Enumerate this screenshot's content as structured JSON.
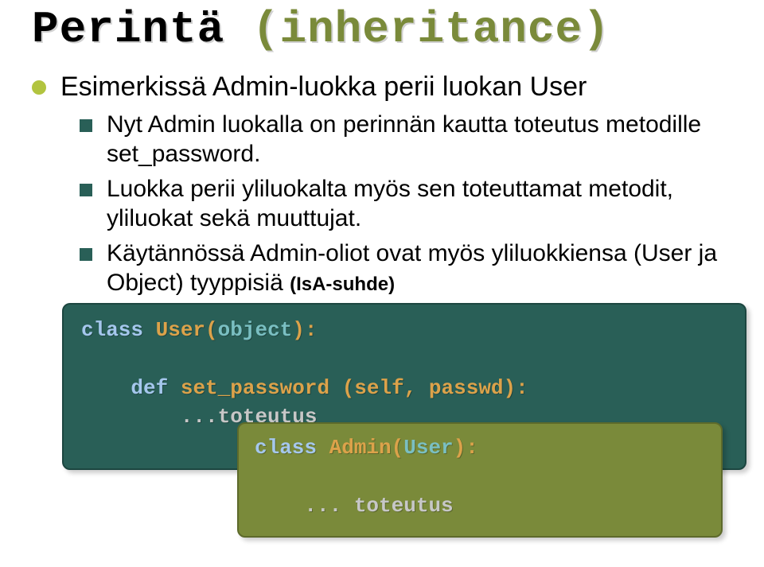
{
  "title": {
    "main": "Perintä",
    "paren": "(inheritance)"
  },
  "bullet": "Esimerkissä Admin-luokka perii luokan User",
  "subs": [
    "Nyt Admin luokalla on perinnän kautta toteutus metodille set_password.",
    "Luokka perii yliluokalta myös sen toteuttamat metodit, yliluokat sekä muuttujat.",
    "Käytännössä Admin-oliot ovat myös yliluokkiensa (User ja Object) tyyppisiä "
  ],
  "isa_label": "(IsA-suhde)",
  "code1": {
    "kw_class": "class ",
    "name": "User",
    "paren_open": "(",
    "parent": "object",
    "paren_close": "):",
    "blank": "",
    "def_indent": "    ",
    "kw_def": "def ",
    "method": "set_password ",
    "args": "(self, passwd):",
    "body_indent": "        ",
    "body": "...toteutus"
  },
  "code2": {
    "kw_class": "class ",
    "name": "Admin",
    "paren_open": "(",
    "parent": "User",
    "paren_close": "):",
    "blank": "",
    "body_indent": "    ",
    "body": "... toteutus"
  }
}
